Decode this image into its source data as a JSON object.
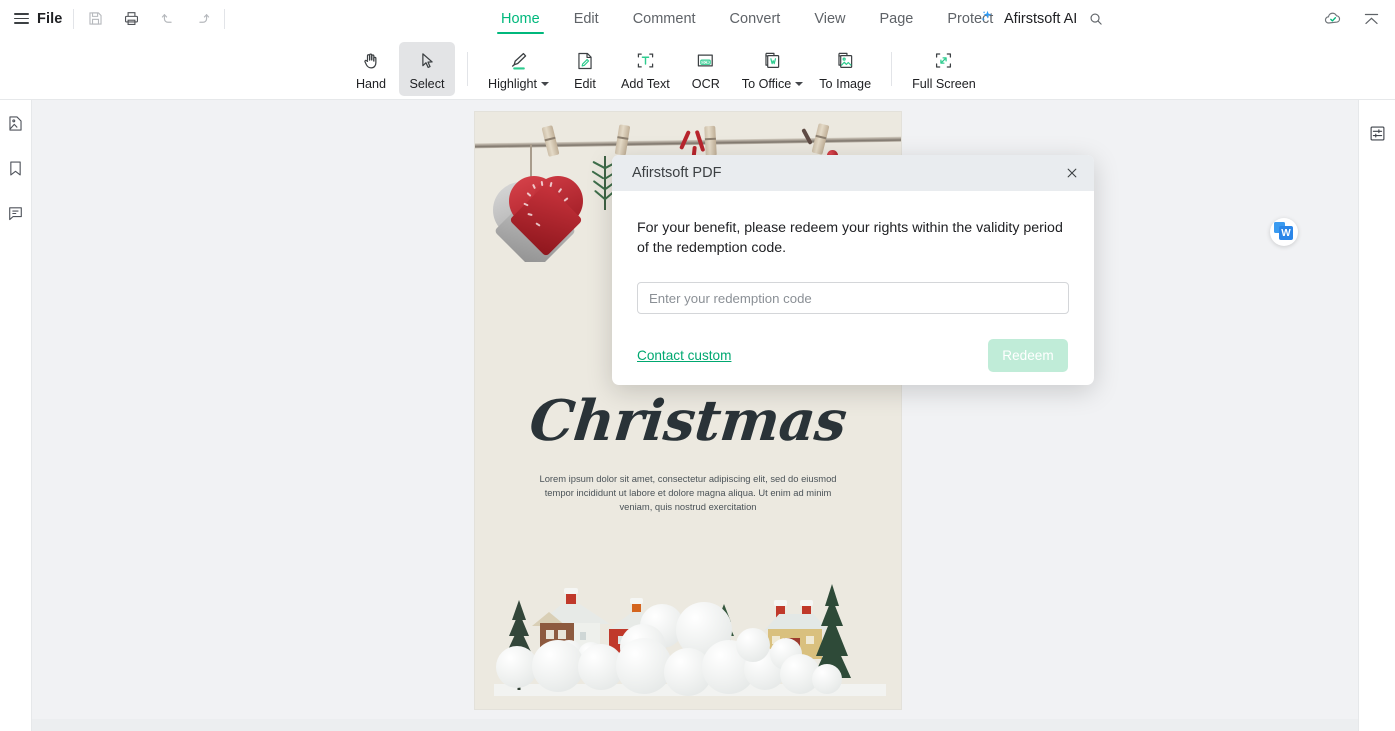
{
  "header": {
    "menu_icon": "hamburger-icon",
    "file_label": "File",
    "quick_actions": [
      {
        "name": "save-icon",
        "label": "Save",
        "disabled": true
      },
      {
        "name": "print-icon",
        "label": "Print",
        "disabled": false
      },
      {
        "name": "undo-icon",
        "label": "Undo",
        "disabled": true
      },
      {
        "name": "redo-icon",
        "label": "Redo",
        "disabled": true
      }
    ],
    "tabs": [
      {
        "label": "Home",
        "active": true
      },
      {
        "label": "Edit",
        "active": false
      },
      {
        "label": "Comment",
        "active": false
      },
      {
        "label": "Convert",
        "active": false
      },
      {
        "label": "View",
        "active": false
      },
      {
        "label": "Page",
        "active": false
      },
      {
        "label": "Protect",
        "active": false
      }
    ],
    "ai_label": "Afirstsoft AI",
    "ai_icon": "sparkle-icon",
    "search_icon": "search-icon",
    "cloud_icon": "cloud-check-icon",
    "collapse_icon": "collapse-ribbon-icon"
  },
  "ribbon": {
    "tools": [
      {
        "label": "Hand",
        "icon": "hand-icon",
        "active": false,
        "dropdown": false
      },
      {
        "label": "Select",
        "icon": "cursor-arrow-icon",
        "active": true,
        "dropdown": false
      },
      {
        "label": "Highlight",
        "icon": "highlighter-icon",
        "active": false,
        "dropdown": true
      },
      {
        "label": "Edit",
        "icon": "edit-page-icon",
        "active": false,
        "dropdown": false
      },
      {
        "label": "Add Text",
        "icon": "add-text-icon",
        "active": false,
        "dropdown": false
      },
      {
        "label": "OCR",
        "icon": "ocr-icon",
        "active": false,
        "dropdown": false
      },
      {
        "label": "To Office",
        "icon": "to-office-icon",
        "active": false,
        "dropdown": true
      },
      {
        "label": "To Image",
        "icon": "to-image-icon",
        "active": false,
        "dropdown": false
      },
      {
        "label": "Full Screen",
        "icon": "full-screen-icon",
        "active": false,
        "dropdown": false
      }
    ]
  },
  "left_sidebar": {
    "items": [
      {
        "name": "thumbnails-icon",
        "label": "Thumbnails"
      },
      {
        "name": "bookmark-icon",
        "label": "Bookmarks"
      },
      {
        "name": "comment-icon",
        "label": "Comments"
      }
    ]
  },
  "right_sidebar": {
    "items": [
      {
        "name": "properties-sliders-icon",
        "label": "Properties"
      }
    ]
  },
  "floating": {
    "word_badge": {
      "name": "convert-to-word-badge",
      "letter": "W"
    }
  },
  "document": {
    "title": "Christmas",
    "body": "Lorem ipsum dolor sit amet, consectetur adipiscing elit, sed do eiusmod tempor incididunt ut labore et dolore magna aliqua. Ut enim ad minim veniam, quis nostrud exercitation"
  },
  "dialog": {
    "title": "Afirstsoft PDF",
    "close_icon": "close-icon",
    "message": "For your benefit, please redeem your rights within the validity period of the redemption code.",
    "input_placeholder": "Enter your redemption code",
    "input_value": "",
    "contact_link": "Contact custom",
    "redeem_button": "Redeem"
  },
  "colors": {
    "accent_green": "#00b87c",
    "link_green": "#00a870",
    "button_disabled": "#c0ecd8",
    "canvas_bg": "#f1f2f4",
    "page_bg": "#ece9e0",
    "dialog_header": "#e9ecef"
  }
}
